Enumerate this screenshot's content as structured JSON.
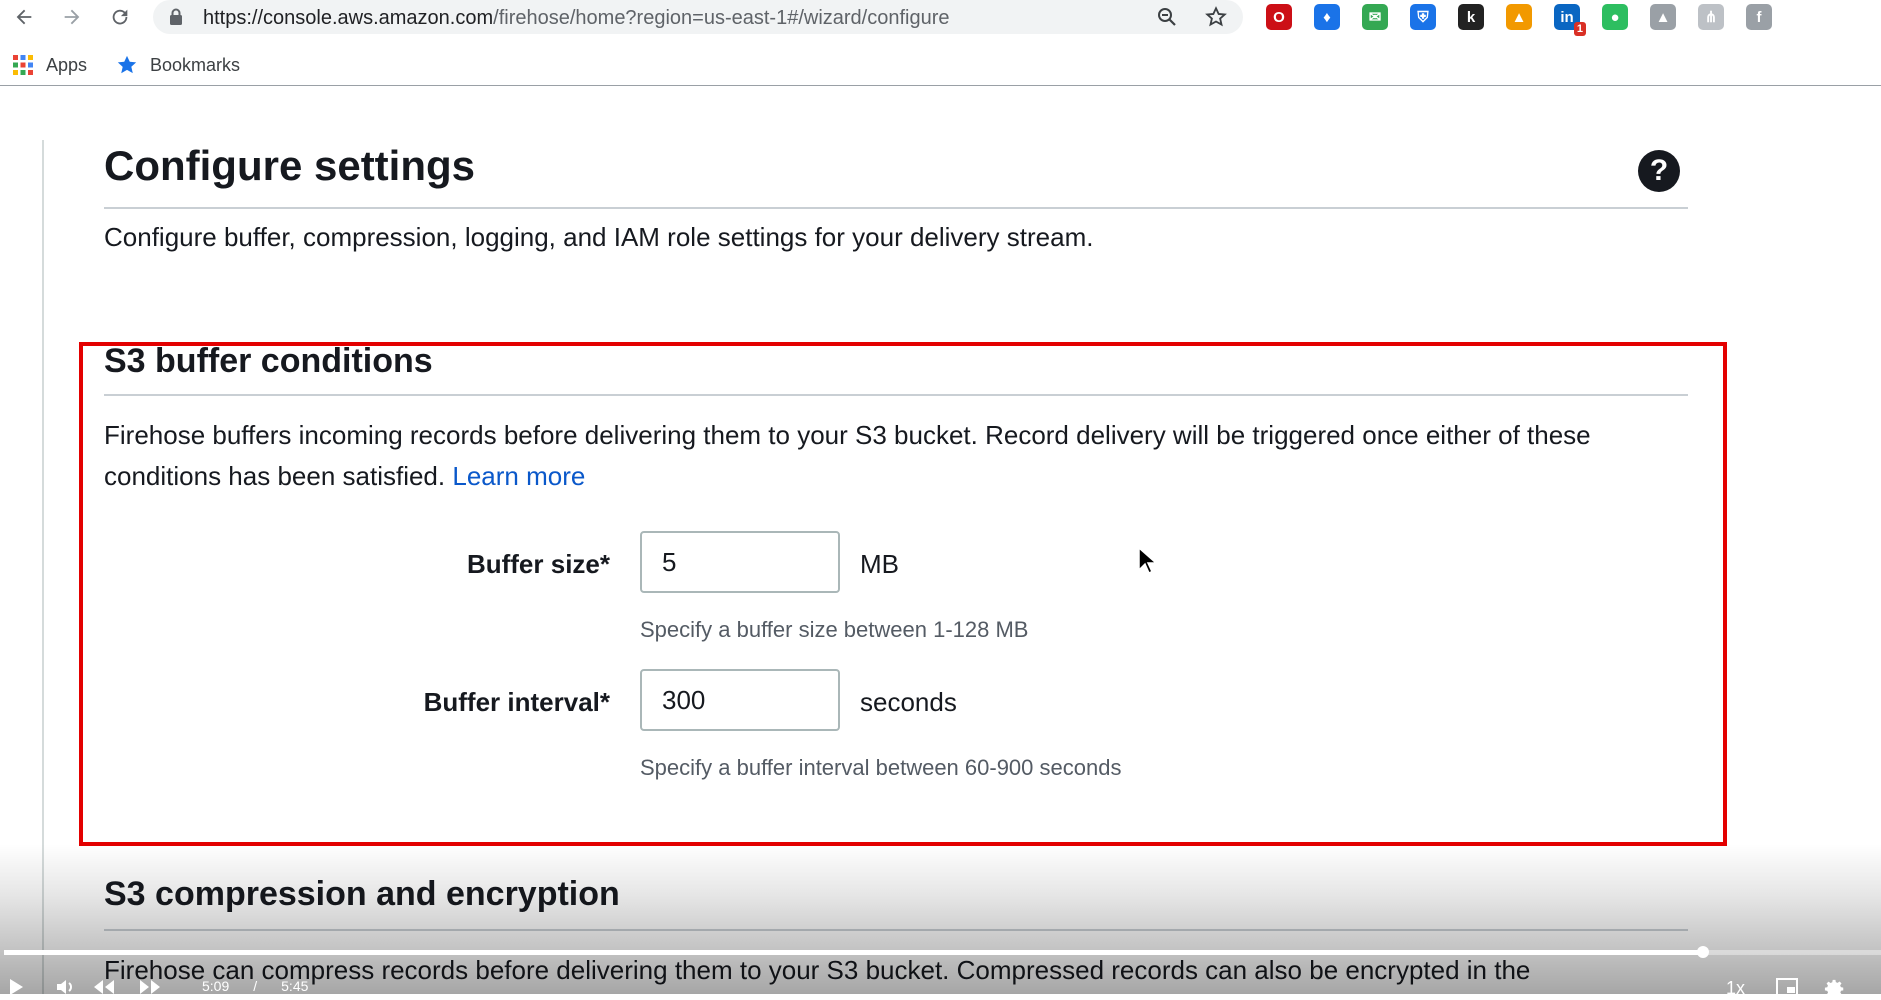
{
  "browser": {
    "url_host": "https://console.aws.amazon.com",
    "url_path": "/firehose/home?region=us-east-1#/wizard/configure",
    "bookmarks": [
      {
        "label": "Apps"
      },
      {
        "label": "Bookmarks"
      }
    ],
    "extensions": [
      {
        "icon": "opera-icon",
        "color": "#cc0f16",
        "glyph": "O"
      },
      {
        "icon": "key-icon",
        "color": "#1a73e8",
        "glyph": "♦"
      },
      {
        "icon": "mail-icon",
        "color": "#34a853",
        "glyph": "✉"
      },
      {
        "icon": "shield-icon",
        "color": "#1a73e8",
        "glyph": "⛨"
      },
      {
        "icon": "k-extension-icon",
        "color": "#222222",
        "glyph": "k"
      },
      {
        "icon": "triangle-icon",
        "color": "#f29900",
        "glyph": "▲"
      },
      {
        "icon": "linkedin-icon",
        "color": "#0a66c2",
        "glyph": "in"
      },
      {
        "icon": "evernote-icon",
        "color": "#2dbe60",
        "glyph": "●"
      },
      {
        "icon": "drive-icon",
        "color": "#9aa0a6",
        "glyph": "▲"
      },
      {
        "icon": "sitemap-icon",
        "color": "#bdc1c6",
        "glyph": "⋔"
      },
      {
        "icon": "facebook-icon",
        "color": "#9aa0a6",
        "glyph": "f"
      }
    ],
    "linkedin_badge": "1"
  },
  "page": {
    "title": "Configure settings",
    "description": "Configure buffer, compression, logging, and IAM role settings for your delivery stream."
  },
  "buffer_section": {
    "title": "S3 buffer conditions",
    "description": "Firehose buffers incoming records before delivering them to your S3 bucket. Record delivery will be triggered once either of these conditions has been satisfied.",
    "learn_more": "Learn more",
    "buffer_size": {
      "label": "Buffer size*",
      "value": "5",
      "unit": "MB",
      "hint": "Specify a buffer size between 1-128 MB"
    },
    "buffer_interval": {
      "label": "Buffer interval*",
      "value": "300",
      "unit": "seconds",
      "hint": "Specify a buffer interval between 60-900 seconds"
    }
  },
  "compression_section": {
    "title": "S3 compression and encryption",
    "description": "Firehose can compress records before delivering them to your S3 bucket. Compressed records can also be encrypted in the"
  },
  "video": {
    "current_time": "5:09",
    "separator": "/",
    "duration": "5:45",
    "progress_fraction": 0.905,
    "speed": "1x"
  }
}
